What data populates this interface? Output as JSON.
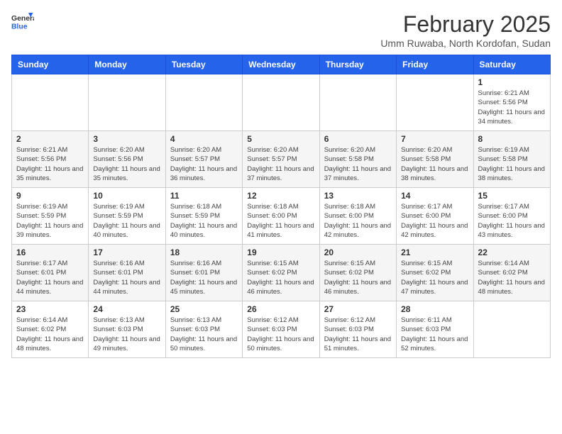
{
  "header": {
    "logo_general": "General",
    "logo_blue": "Blue",
    "month_year": "February 2025",
    "location": "Umm Ruwaba, North Kordofan, Sudan"
  },
  "weekdays": [
    "Sunday",
    "Monday",
    "Tuesday",
    "Wednesday",
    "Thursday",
    "Friday",
    "Saturday"
  ],
  "weeks": [
    [
      {
        "day": "",
        "info": ""
      },
      {
        "day": "",
        "info": ""
      },
      {
        "day": "",
        "info": ""
      },
      {
        "day": "",
        "info": ""
      },
      {
        "day": "",
        "info": ""
      },
      {
        "day": "",
        "info": ""
      },
      {
        "day": "1",
        "info": "Sunrise: 6:21 AM\nSunset: 5:56 PM\nDaylight: 11 hours and 34 minutes."
      }
    ],
    [
      {
        "day": "2",
        "info": "Sunrise: 6:21 AM\nSunset: 5:56 PM\nDaylight: 11 hours and 35 minutes."
      },
      {
        "day": "3",
        "info": "Sunrise: 6:20 AM\nSunset: 5:56 PM\nDaylight: 11 hours and 35 minutes."
      },
      {
        "day": "4",
        "info": "Sunrise: 6:20 AM\nSunset: 5:57 PM\nDaylight: 11 hours and 36 minutes."
      },
      {
        "day": "5",
        "info": "Sunrise: 6:20 AM\nSunset: 5:57 PM\nDaylight: 11 hours and 37 minutes."
      },
      {
        "day": "6",
        "info": "Sunrise: 6:20 AM\nSunset: 5:58 PM\nDaylight: 11 hours and 37 minutes."
      },
      {
        "day": "7",
        "info": "Sunrise: 6:20 AM\nSunset: 5:58 PM\nDaylight: 11 hours and 38 minutes."
      },
      {
        "day": "8",
        "info": "Sunrise: 6:19 AM\nSunset: 5:58 PM\nDaylight: 11 hours and 38 minutes."
      }
    ],
    [
      {
        "day": "9",
        "info": "Sunrise: 6:19 AM\nSunset: 5:59 PM\nDaylight: 11 hours and 39 minutes."
      },
      {
        "day": "10",
        "info": "Sunrise: 6:19 AM\nSunset: 5:59 PM\nDaylight: 11 hours and 40 minutes."
      },
      {
        "day": "11",
        "info": "Sunrise: 6:18 AM\nSunset: 5:59 PM\nDaylight: 11 hours and 40 minutes."
      },
      {
        "day": "12",
        "info": "Sunrise: 6:18 AM\nSunset: 6:00 PM\nDaylight: 11 hours and 41 minutes."
      },
      {
        "day": "13",
        "info": "Sunrise: 6:18 AM\nSunset: 6:00 PM\nDaylight: 11 hours and 42 minutes."
      },
      {
        "day": "14",
        "info": "Sunrise: 6:17 AM\nSunset: 6:00 PM\nDaylight: 11 hours and 42 minutes."
      },
      {
        "day": "15",
        "info": "Sunrise: 6:17 AM\nSunset: 6:00 PM\nDaylight: 11 hours and 43 minutes."
      }
    ],
    [
      {
        "day": "16",
        "info": "Sunrise: 6:17 AM\nSunset: 6:01 PM\nDaylight: 11 hours and 44 minutes."
      },
      {
        "day": "17",
        "info": "Sunrise: 6:16 AM\nSunset: 6:01 PM\nDaylight: 11 hours and 44 minutes."
      },
      {
        "day": "18",
        "info": "Sunrise: 6:16 AM\nSunset: 6:01 PM\nDaylight: 11 hours and 45 minutes."
      },
      {
        "day": "19",
        "info": "Sunrise: 6:15 AM\nSunset: 6:02 PM\nDaylight: 11 hours and 46 minutes."
      },
      {
        "day": "20",
        "info": "Sunrise: 6:15 AM\nSunset: 6:02 PM\nDaylight: 11 hours and 46 minutes."
      },
      {
        "day": "21",
        "info": "Sunrise: 6:15 AM\nSunset: 6:02 PM\nDaylight: 11 hours and 47 minutes."
      },
      {
        "day": "22",
        "info": "Sunrise: 6:14 AM\nSunset: 6:02 PM\nDaylight: 11 hours and 48 minutes."
      }
    ],
    [
      {
        "day": "23",
        "info": "Sunrise: 6:14 AM\nSunset: 6:02 PM\nDaylight: 11 hours and 48 minutes."
      },
      {
        "day": "24",
        "info": "Sunrise: 6:13 AM\nSunset: 6:03 PM\nDaylight: 11 hours and 49 minutes."
      },
      {
        "day": "25",
        "info": "Sunrise: 6:13 AM\nSunset: 6:03 PM\nDaylight: 11 hours and 50 minutes."
      },
      {
        "day": "26",
        "info": "Sunrise: 6:12 AM\nSunset: 6:03 PM\nDaylight: 11 hours and 50 minutes."
      },
      {
        "day": "27",
        "info": "Sunrise: 6:12 AM\nSunset: 6:03 PM\nDaylight: 11 hours and 51 minutes."
      },
      {
        "day": "28",
        "info": "Sunrise: 6:11 AM\nSunset: 6:03 PM\nDaylight: 11 hours and 52 minutes."
      },
      {
        "day": "",
        "info": ""
      }
    ]
  ]
}
